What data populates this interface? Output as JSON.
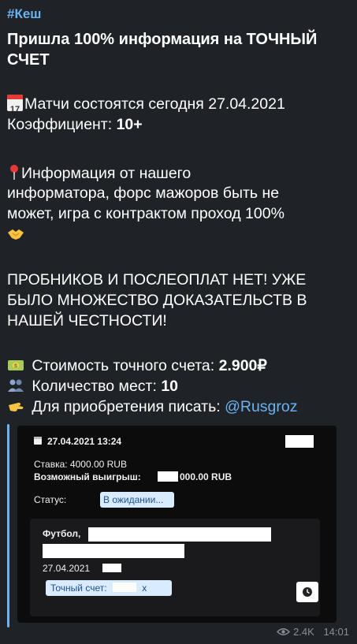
{
  "post": {
    "tag": "#Кеш",
    "title": "Пришла 100% информация на ТОЧНЫЙ СЧЕТ",
    "line1": "Матчи состоятся сегодня 27.04.2021",
    "line2_label": "Коэффициент: ",
    "line2_value": "10+",
    "info_l1": "Информация от нашего",
    "info_l2": "информатора, форс мажоров быть не",
    "info_l3": "может, игра с контрактом проход 100%",
    "warn_l1": "ПРОБНИКОВ И ПОСЛЕОПЛАТ НЕТ! УЖЕ",
    "warn_l2": "БЫЛО МНОЖЕСТВО ДОКАЗАТЕЛЬСТВ В",
    "warn_l3": "НАШЕЙ ЧЕСТНОСТИ!",
    "price_label": " Стоимость точного счета: ",
    "price_value": "2.900₽",
    "seats_label": " Количество мест: ",
    "seats_value": "10",
    "buy_label": " Для приобретения писать: ",
    "buy_link": "@Rusgroz",
    "calendar_day": "17"
  },
  "bet": {
    "datetime": "27.04.2021 13:24",
    "stake": "Ставка: 4000.00 RUB",
    "win_label": "Возможный выигрыш:",
    "win_value": "000.00 RUB",
    "status_label": "Статус:",
    "status_value": "В ожидании...",
    "sport": "Футбол,",
    "date": "27.04.2021",
    "exact_label": "Точный счет:",
    "exact_x": "x"
  },
  "footer": {
    "views": "2.4K",
    "time": "14:01"
  },
  "colors": {
    "link": "#6ab3f3",
    "background": "#1f2227",
    "screenshot_bg": "#0c0c0d",
    "chip": "#d9ecff"
  },
  "icons": [
    "calendar-icon",
    "pin-icon",
    "handshake-icon",
    "money-icon",
    "people-icon",
    "pointing-hand-icon",
    "calendar-small-icon",
    "clock-icon",
    "eye-icon"
  ]
}
